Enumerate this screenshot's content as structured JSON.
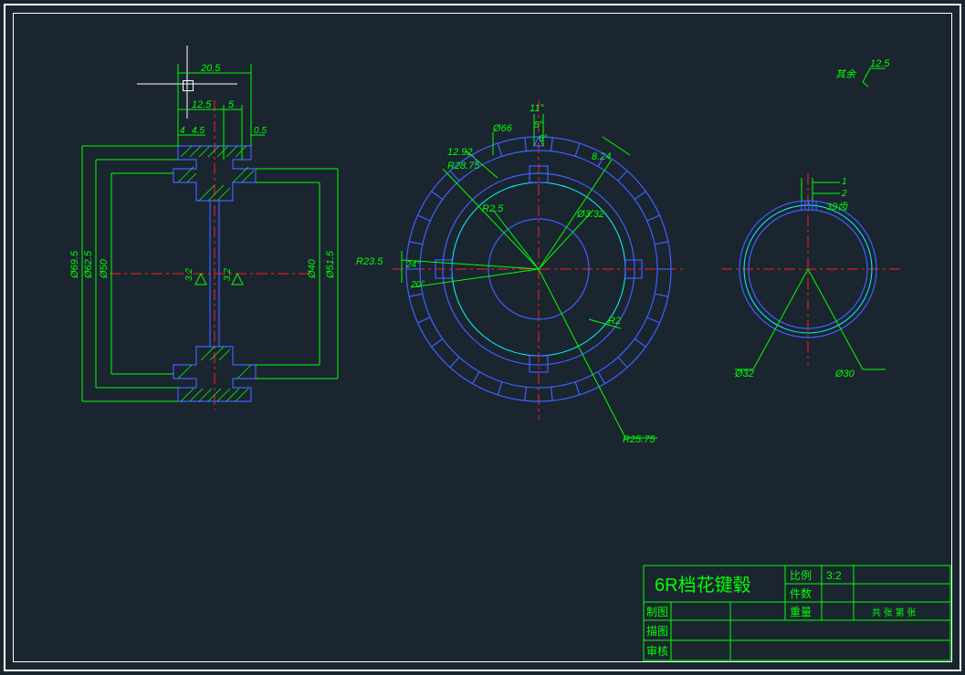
{
  "title_block": {
    "part_name": "6R档花键毂",
    "scale_label": "比例",
    "scale_value": "3:2",
    "qty_label": "件数",
    "qty_value": "",
    "weight_label": "重量",
    "weight_value": "",
    "drawn_label": "制图",
    "traced_label": "描图",
    "checked_label": "审核",
    "sheet_note": "共 张 第 张"
  },
  "surface_finish": {
    "prefix": "其余",
    "value": "12.5"
  },
  "left_view": {
    "dims": {
      "d1": "Ø69.5",
      "d2": "Ø62.5",
      "d3": "Ø50",
      "d4": "Ø40",
      "d5": "Ø51.5",
      "w1": "20.5",
      "w2": "12.5",
      "w3": "5",
      "w4": "4",
      "w5": "4.5",
      "w6": "0.5",
      "sf_left": "3.2",
      "sf_right": "3.2"
    }
  },
  "middle_view": {
    "dims": {
      "d_outer": "Ø66",
      "r1": "R28.75",
      "r2": "R23.5",
      "r3": "R25.75",
      "r4": "R2.5",
      "r5": "R2",
      "a1": "11°",
      "a2": "5°",
      "a3": "6°",
      "a4": "24°",
      "a5": "20°",
      "l1": "12.92",
      "l2": "8.24",
      "d_small": "Ø3.32"
    }
  },
  "right_view": {
    "dims": {
      "d1": "Ø32",
      "d2": "Ø30",
      "t1": "1",
      "t2": "2",
      "teeth": "39齿"
    }
  }
}
